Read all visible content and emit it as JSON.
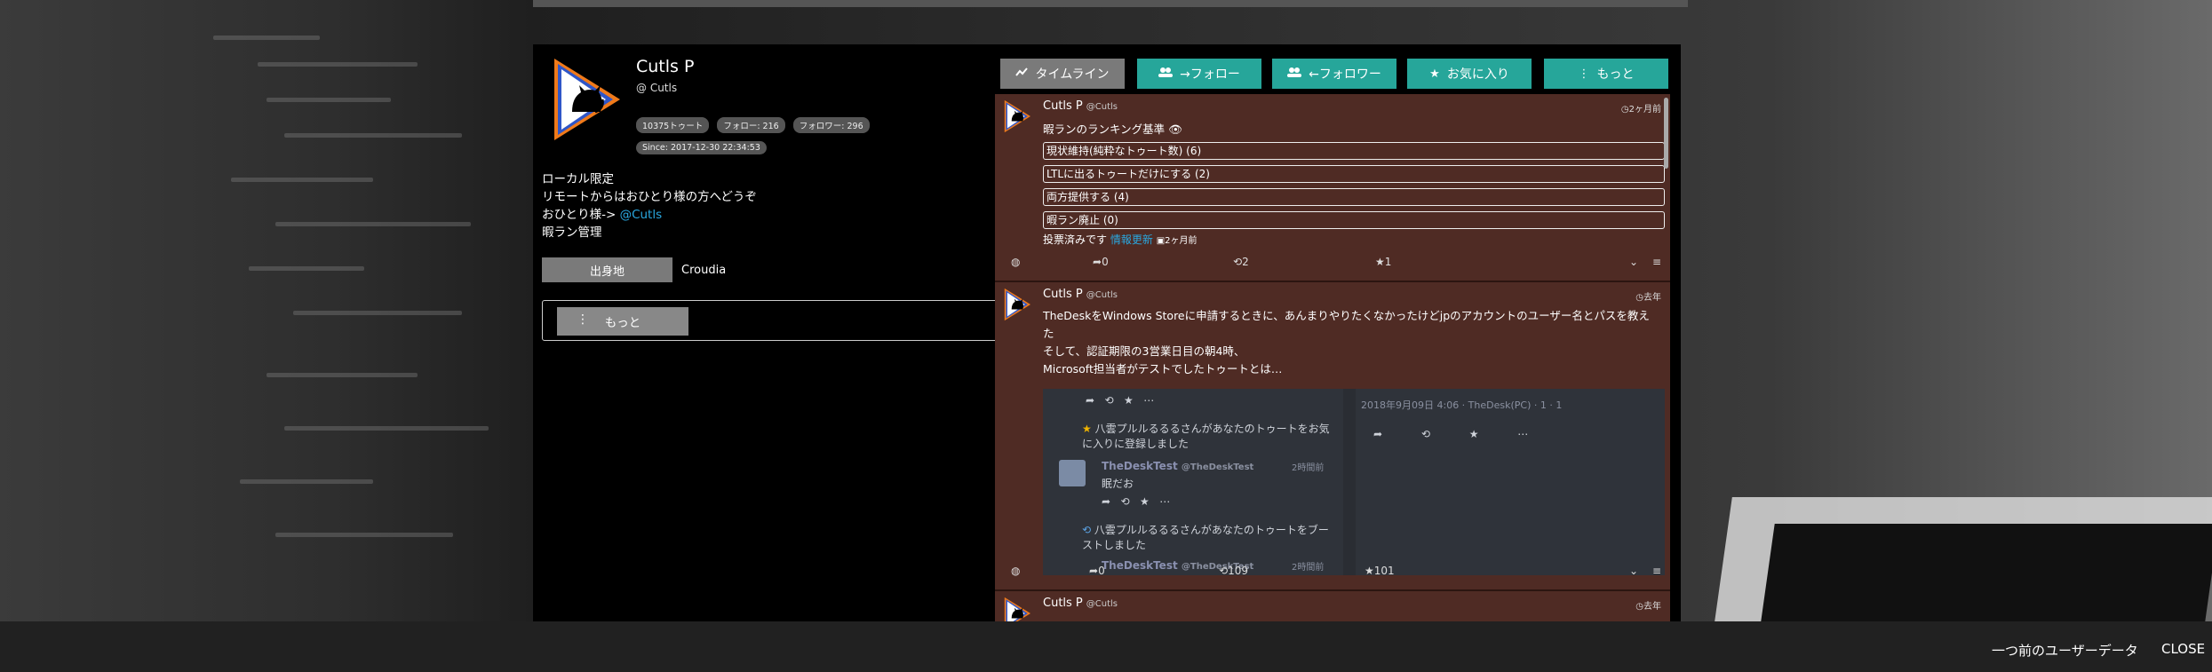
{
  "bottom_bar": {
    "prev_user": "一つ前のユーザーデータ",
    "close": "CLOSE"
  },
  "profile": {
    "display_name": "Cutls P",
    "acct": "@ Cutls",
    "badges": [
      "10375トゥート",
      "フォロー: 216",
      "フォロワー: 296",
      "Since: 2017-12-30 22:34:53"
    ],
    "bio_lines": [
      "ローカル限定",
      "リモートからはおひとり様の方へどうぞ",
      "おひとり様->",
      "暇ラン管理"
    ],
    "bio_link": "@Cutls",
    "field_name": "出身地",
    "field_value": "Croudia",
    "more_label": "もっと"
  },
  "tabs": [
    {
      "label": "タイムライン",
      "icon": "chart-line-icon"
    },
    {
      "label": "→フォロー",
      "icon": "people-icon"
    },
    {
      "label": "←フォロワー",
      "icon": "people-icon"
    },
    {
      "label": "お気に入り",
      "icon": "star-icon"
    },
    {
      "label": "もっと",
      "icon": "more-vertical-icon"
    }
  ],
  "posts": [
    {
      "name": "Cutls P",
      "handle": "@Cutls",
      "time": "2ヶ月前",
      "content": "暇ランのランキング基準 👁",
      "poll_options": [
        "現状維持(純粋なトゥート数) (6)",
        "LTLに出るトゥートだけにする (2)",
        "両方提供する (4)",
        "暇ラン廃止 (0)"
      ],
      "poll_footer": "投票済みです",
      "poll_refresh": "情報更新",
      "poll_time": "2ヶ月前",
      "reply_count": "0",
      "boost_count": "2",
      "fav_count": "1"
    },
    {
      "name": "Cutls P",
      "handle": "@Cutls",
      "time": "去年",
      "content_lines": [
        "TheDeskをWindows Storeに申請するときに、あんまりやりたくなかったけどjpのアカウントのユーザー名とパスを教えた",
        "そして、認証期限の3営業日目の朝4時、",
        "Microsoft担当者がテストでしたトゥートとは…"
      ],
      "media": {
        "notif1": "八雲プルルるるるさんがあなたのトゥートをお気に入りに登録しました",
        "user": "TheDeskTest",
        "user_handle": "@TheDeskTest",
        "ago": "2時間前",
        "body": "眠だお",
        "notif2": "八雲プルルるるるさんがあなたのトゥートをブーストしました",
        "right_meta": "2018年9月09日 4:06 · TheDesk(PC) · 1 · 1"
      },
      "reply_count": "0",
      "boost_count": "109",
      "fav_count": "101"
    },
    {
      "name": "Cutls P",
      "handle": "@Cutls",
      "time": "去年"
    }
  ],
  "colors": {
    "accent": "#26a69a",
    "timeline_bg": "#4f2b24",
    "link": "#2aa8e0",
    "tab_active": "#7a7a7a"
  }
}
